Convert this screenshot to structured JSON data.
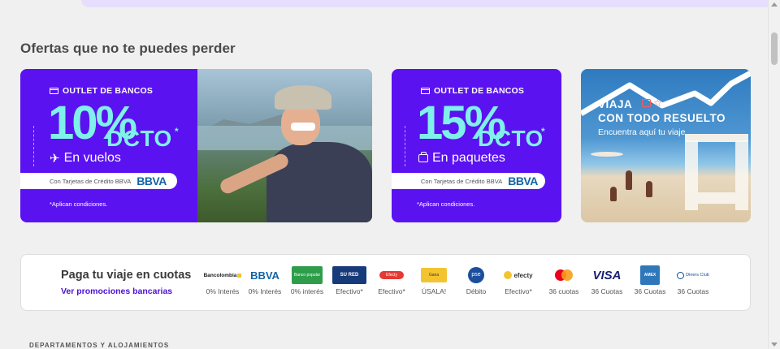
{
  "section_title": "Ofertas que no te puedes perder",
  "promo1": {
    "outlet": "OUTLET DE BANCOS",
    "percent": "10%",
    "dcto": "DCTO",
    "asterisk": "*",
    "product": "En vuelos",
    "product_icon": "plane-icon",
    "bank_text": "Con Tarjetas de Crédito BBVA",
    "bank_logo": "BBVA",
    "conditions": "*Aplican condiciones."
  },
  "promo2": {
    "outlet": "OUTLET DE BANCOS",
    "percent": "15%",
    "dcto": "DCTO",
    "asterisk": "*",
    "product": "En paquetes",
    "product_icon": "suitcase-icon",
    "bank_text": "Con Tarjetas de Crédito BBVA",
    "bank_logo": "BBVA",
    "conditions": "*Aplican condiciones."
  },
  "promo3": {
    "line1": "VIAJA",
    "line2": "CON TODO RESUELTO",
    "line3": "Encuentra aquí tu viaje"
  },
  "payments": {
    "title": "Paga tu viaje en cuotas",
    "link": "Ver promociones bancarias",
    "methods": [
      {
        "logo": "Bancolombia",
        "label": "0% Interés",
        "color": "#1a1a1a"
      },
      {
        "logo": "BBVA",
        "label": "0% Interés",
        "color": "#1464a5"
      },
      {
        "logo": "Banco popular",
        "label": "0% interés",
        "color": "#2e9d4a"
      },
      {
        "logo": "SU RED",
        "label": "Efectivo*",
        "color": "#173a7a"
      },
      {
        "logo": "Efecty",
        "label": "Efectivo*",
        "color": "#e53935"
      },
      {
        "logo": "Gana",
        "label": "ÚSALA!",
        "color": "#f4c430"
      },
      {
        "logo": "pse",
        "label": "Débito",
        "color": "#1b4f9c"
      },
      {
        "logo": "efecty",
        "label": "Efectivo*",
        "color": "#f4c430"
      },
      {
        "logo": "mastercard",
        "label": "36 cuotas",
        "color": "#eb001b"
      },
      {
        "logo": "VISA",
        "label": "36 Cuotas",
        "color": "#1a1f71"
      },
      {
        "logo": "AMEX",
        "label": "36 Cuotas",
        "color": "#2e77bb"
      },
      {
        "logo": "Diners Club",
        "label": "36 Cuotas",
        "color": "#0a4c97"
      }
    ]
  },
  "bottom_label": "DEPARTAMENTOS Y ALOJAMIENTOS"
}
